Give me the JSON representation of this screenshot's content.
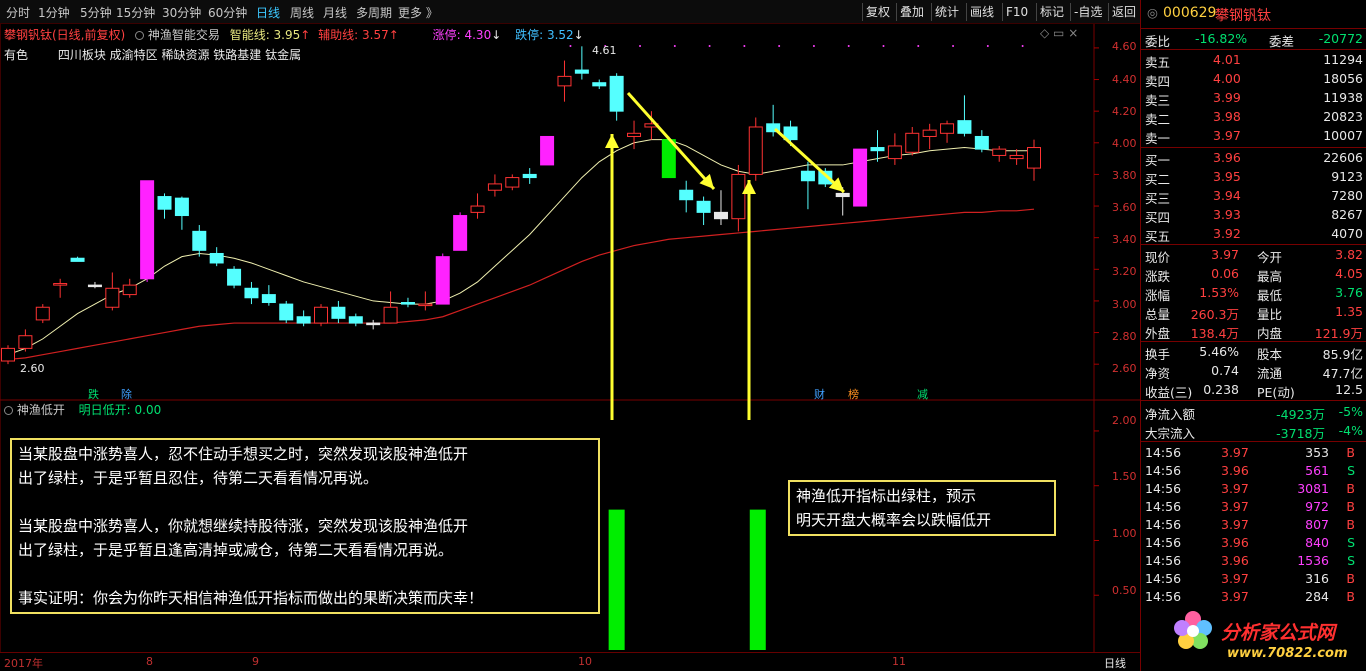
{
  "toolbar": {
    "periods": [
      "分时",
      "1分钟",
      "5分钟",
      "15分钟",
      "30分钟",
      "60分钟",
      "日线",
      "周线",
      "月线",
      "多周期",
      "更多 》"
    ],
    "active_period": "日线",
    "buttons": [
      "复权",
      "叠加",
      "统计",
      "画线",
      "F10",
      "标记",
      "-自选",
      "返回"
    ]
  },
  "chart_header": {
    "stock": "攀钢钒钛(日线,前复权)",
    "indicator": "神渔智能交易",
    "zhineng": "智能线: 3.95",
    "fuzhu": "辅助线: 3.57",
    "zhangting": "涨停: 4.30",
    "dieting": "跌停: 3.52",
    "sector_label": "有色",
    "sectors": "四川板块  成渝特区  稀缺资源  铁路基建  钛金属"
  },
  "price_axis": [
    "4.60",
    "4.40",
    "4.20",
    "4.00",
    "3.80",
    "3.60",
    "3.40",
    "3.20",
    "3.00",
    "2.80",
    "2.60"
  ],
  "sub_axis": [
    "2.00",
    "1.50",
    "1.00",
    "0.50"
  ],
  "markers": {
    "high": "4.61",
    "low": "2.60",
    "die": "跌",
    "chu": "除",
    "cai": "财",
    "bang": "榜",
    "jian": "减"
  },
  "sub_header": {
    "name": "神渔低开",
    "value": "明日低开: 0.00"
  },
  "note_left": {
    "p1_l1": "当某股盘中涨势喜人，忍不住动手想买之时，突然发现该股神渔低开",
    "p1_l2": "出了绿柱，于是乎暂且忍住，待第二天看看情况再说。",
    "p2_l1": "当某股盘中涨势喜人，你就想继续持股待涨，突然发现该股神渔低开",
    "p2_l2": "出了绿柱，于是乎暂且逢高清掉或减仓，待第二天看看情况再说。",
    "p3": "事实证明：你会为你昨天相信神渔低开指标而做出的果断决策而庆幸！"
  },
  "note_right": {
    "l1": "神渔低开指标出绿柱，预示",
    "l2": "明天开盘大概率会以跌幅低开"
  },
  "date_axis": [
    "2017年",
    "8",
    "9",
    "10",
    "11"
  ],
  "date_axis_right": "日线",
  "panel": {
    "code": "000629",
    "name": "攀钢钒钛",
    "weibi_label": "委比",
    "weibi": "-16.82%",
    "weicha_label": "委差",
    "weicha": "-20772",
    "sell": [
      {
        "label": "卖五",
        "price": "4.01",
        "vol": "11294"
      },
      {
        "label": "卖四",
        "price": "4.00",
        "vol": "18056"
      },
      {
        "label": "卖三",
        "price": "3.99",
        "vol": "11938"
      },
      {
        "label": "卖二",
        "price": "3.98",
        "vol": "20823"
      },
      {
        "label": "卖一",
        "price": "3.97",
        "vol": "10007"
      }
    ],
    "buy": [
      {
        "label": "买一",
        "price": "3.96",
        "vol": "22606"
      },
      {
        "label": "买二",
        "price": "3.95",
        "vol": "9123"
      },
      {
        "label": "买三",
        "price": "3.94",
        "vol": "7280"
      },
      {
        "label": "买四",
        "price": "3.93",
        "vol": "8267"
      },
      {
        "label": "买五",
        "price": "3.92",
        "vol": "4070"
      }
    ],
    "quote": [
      {
        "l1": "现价",
        "v1": "3.97",
        "l2": "今开",
        "v2": "3.82"
      },
      {
        "l1": "涨跌",
        "v1": "0.06",
        "l2": "最高",
        "v2": "4.05"
      },
      {
        "l1": "涨幅",
        "v1": "1.53%",
        "l2": "最低",
        "v2": "3.76"
      },
      {
        "l1": "总量",
        "v1": "260.3万",
        "l2": "量比",
        "v2": "1.35"
      },
      {
        "l1": "外盘",
        "v1": "138.4万",
        "l2": "内盘",
        "v2": "121.9万"
      }
    ],
    "stats": [
      {
        "l1": "换手",
        "v1": "5.46%",
        "l2": "股本",
        "v2": "85.9亿"
      },
      {
        "l1": "净资",
        "v1": "0.74",
        "l2": "流通",
        "v2": "47.7亿"
      },
      {
        "l1": "收益(三)",
        "v1": "0.238",
        "l2": "PE(动)",
        "v2": "12.5"
      }
    ],
    "flow": [
      {
        "label": "净流入额",
        "value": "-4923万",
        "pct": "-5%"
      },
      {
        "label": "大宗流入",
        "value": "-3718万",
        "pct": "-4%"
      }
    ],
    "ticks": [
      {
        "time": "14:56",
        "price": "3.97",
        "vol": "353",
        "bs": "B"
      },
      {
        "time": "14:56",
        "price": "3.96",
        "vol": "561",
        "bs": "S"
      },
      {
        "time": "14:56",
        "price": "3.97",
        "vol": "3081",
        "bs": "B"
      },
      {
        "time": "14:56",
        "price": "3.97",
        "vol": "972",
        "bs": "B"
      },
      {
        "time": "14:56",
        "price": "3.97",
        "vol": "807",
        "bs": "B"
      },
      {
        "time": "14:56",
        "price": "3.96",
        "vol": "840",
        "bs": "S"
      },
      {
        "time": "14:56",
        "price": "3.96",
        "vol": "1536",
        "bs": "S"
      },
      {
        "time": "14:56",
        "price": "3.97",
        "vol": "316",
        "bs": "B"
      },
      {
        "time": "14:56",
        "price": "3.97",
        "vol": "284",
        "bs": "B"
      }
    ],
    "watermark": "分析家公式网",
    "watermark_url": "www.70822.com"
  },
  "colors": {
    "up": "#ff3333",
    "up_fill": "#000000",
    "down": "#55ffff",
    "magenta": "#ff22ff",
    "yellow_line": "#f0f0b0",
    "red_line": "#d02020",
    "green_bar": "#00ee00",
    "arrow": "#ffff30"
  },
  "chart_data": {
    "type": "candlestick",
    "title": "攀钢钒钛(日线,前复权)",
    "ylim": [
      2.5,
      4.65
    ],
    "candles": [
      {
        "o": 2.62,
        "h": 2.72,
        "l": 2.6,
        "c": 2.7,
        "dir": "up"
      },
      {
        "o": 2.7,
        "h": 2.82,
        "l": 2.68,
        "c": 2.78,
        "dir": "up"
      },
      {
        "o": 2.88,
        "h": 2.98,
        "l": 2.86,
        "c": 2.96,
        "dir": "up"
      },
      {
        "o": 3.1,
        "h": 3.14,
        "l": 3.02,
        "c": 3.11,
        "dir": "up"
      },
      {
        "o": 3.27,
        "h": 3.28,
        "l": 3.25,
        "c": 3.25,
        "dir": "down"
      },
      {
        "o": 3.1,
        "h": 3.12,
        "l": 3.08,
        "c": 3.1,
        "dir": "flat"
      },
      {
        "o": 2.96,
        "h": 3.18,
        "l": 2.94,
        "c": 3.08,
        "dir": "up"
      },
      {
        "o": 3.04,
        "h": 3.14,
        "l": 3.02,
        "c": 3.1,
        "dir": "up"
      },
      {
        "o": 3.14,
        "h": 3.44,
        "l": 3.12,
        "c": 3.76,
        "dir": "mag"
      },
      {
        "o": 3.66,
        "h": 3.68,
        "l": 3.52,
        "c": 3.58,
        "dir": "down"
      },
      {
        "o": 3.65,
        "h": 3.66,
        "l": 3.45,
        "c": 3.54,
        "dir": "down"
      },
      {
        "o": 3.44,
        "h": 3.48,
        "l": 3.28,
        "c": 3.32,
        "dir": "down"
      },
      {
        "o": 3.3,
        "h": 3.34,
        "l": 3.22,
        "c": 3.24,
        "dir": "down"
      },
      {
        "o": 3.2,
        "h": 3.22,
        "l": 3.08,
        "c": 3.1,
        "dir": "down"
      },
      {
        "o": 3.08,
        "h": 3.12,
        "l": 2.98,
        "c": 3.02,
        "dir": "down"
      },
      {
        "o": 3.04,
        "h": 3.1,
        "l": 2.97,
        "c": 2.99,
        "dir": "down"
      },
      {
        "o": 2.98,
        "h": 3.0,
        "l": 2.86,
        "c": 2.88,
        "dir": "down"
      },
      {
        "o": 2.9,
        "h": 2.94,
        "l": 2.84,
        "c": 2.86,
        "dir": "down"
      },
      {
        "o": 2.86,
        "h": 2.98,
        "l": 2.84,
        "c": 2.96,
        "dir": "up"
      },
      {
        "o": 2.96,
        "h": 3.0,
        "l": 2.86,
        "c": 2.89,
        "dir": "down"
      },
      {
        "o": 2.9,
        "h": 2.92,
        "l": 2.84,
        "c": 2.86,
        "dir": "down"
      },
      {
        "o": 2.86,
        "h": 2.88,
        "l": 2.82,
        "c": 2.85,
        "dir": "flat"
      },
      {
        "o": 2.86,
        "h": 3.06,
        "l": 2.86,
        "c": 2.96,
        "dir": "up"
      },
      {
        "o": 2.98,
        "h": 3.02,
        "l": 2.96,
        "c": 2.99,
        "dir": "down"
      },
      {
        "o": 2.98,
        "h": 3.06,
        "l": 2.94,
        "c": 2.98,
        "dir": "up"
      },
      {
        "o": 2.98,
        "h": 3.3,
        "l": 2.98,
        "c": 3.28,
        "dir": "mag"
      },
      {
        "o": 3.32,
        "h": 3.56,
        "l": 3.32,
        "c": 3.54,
        "dir": "mag"
      },
      {
        "o": 3.56,
        "h": 3.68,
        "l": 3.52,
        "c": 3.6,
        "dir": "up"
      },
      {
        "o": 3.7,
        "h": 3.8,
        "l": 3.66,
        "c": 3.74,
        "dir": "up"
      },
      {
        "o": 3.72,
        "h": 3.8,
        "l": 3.7,
        "c": 3.78,
        "dir": "up"
      },
      {
        "o": 3.8,
        "h": 3.84,
        "l": 3.74,
        "c": 3.78,
        "dir": "down"
      },
      {
        "o": 3.86,
        "h": 4.04,
        "l": 3.86,
        "c": 4.04,
        "dir": "mag"
      },
      {
        "o": 4.36,
        "h": 4.52,
        "l": 4.26,
        "c": 4.42,
        "dir": "up"
      },
      {
        "o": 4.46,
        "h": 4.61,
        "l": 4.4,
        "c": 4.44,
        "dir": "down"
      },
      {
        "o": 4.38,
        "h": 4.4,
        "l": 4.34,
        "c": 4.36,
        "dir": "down"
      },
      {
        "o": 4.42,
        "h": 4.44,
        "l": 4.14,
        "c": 4.2,
        "dir": "down"
      },
      {
        "o": 4.06,
        "h": 4.14,
        "l": 3.96,
        "c": 4.04,
        "dir": "up"
      },
      {
        "o": 4.1,
        "h": 4.2,
        "l": 4.02,
        "c": 4.12,
        "dir": "up"
      },
      {
        "o": 4.02,
        "h": 4.04,
        "l": 3.78,
        "c": 3.78,
        "dir": "green"
      },
      {
        "o": 3.7,
        "h": 3.76,
        "l": 3.56,
        "c": 3.64,
        "dir": "down"
      },
      {
        "o": 3.63,
        "h": 3.66,
        "l": 3.48,
        "c": 3.56,
        "dir": "down"
      },
      {
        "o": 3.56,
        "h": 3.7,
        "l": 3.48,
        "c": 3.52,
        "dir": "flat"
      },
      {
        "o": 3.52,
        "h": 3.86,
        "l": 3.44,
        "c": 3.8,
        "dir": "up"
      },
      {
        "o": 3.8,
        "h": 4.16,
        "l": 3.76,
        "c": 4.1,
        "dir": "up"
      },
      {
        "o": 4.12,
        "h": 4.24,
        "l": 4.04,
        "c": 4.07,
        "dir": "down"
      },
      {
        "o": 4.1,
        "h": 4.14,
        "l": 3.98,
        "c": 4.02,
        "dir": "down"
      },
      {
        "o": 3.82,
        "h": 3.88,
        "l": 3.58,
        "c": 3.76,
        "dir": "down"
      },
      {
        "o": 3.82,
        "h": 3.84,
        "l": 3.72,
        "c": 3.74,
        "dir": "down"
      },
      {
        "o": 3.68,
        "h": 3.72,
        "l": 3.54,
        "c": 3.66,
        "dir": "flat"
      },
      {
        "o": 3.6,
        "h": 3.96,
        "l": 3.6,
        "c": 3.96,
        "dir": "mag"
      },
      {
        "o": 3.95,
        "h": 4.08,
        "l": 3.88,
        "c": 3.97,
        "dir": "down"
      },
      {
        "o": 3.9,
        "h": 4.06,
        "l": 3.86,
        "c": 3.98,
        "dir": "up"
      },
      {
        "o": 3.94,
        "h": 4.1,
        "l": 3.92,
        "c": 4.06,
        "dir": "up"
      },
      {
        "o": 4.04,
        "h": 4.12,
        "l": 3.96,
        "c": 4.08,
        "dir": "up"
      },
      {
        "o": 4.06,
        "h": 4.14,
        "l": 4.0,
        "c": 4.12,
        "dir": "up"
      },
      {
        "o": 4.14,
        "h": 4.3,
        "l": 4.04,
        "c": 4.06,
        "dir": "down"
      },
      {
        "o": 4.04,
        "h": 4.08,
        "l": 3.94,
        "c": 3.96,
        "dir": "down"
      },
      {
        "o": 3.96,
        "h": 3.98,
        "l": 3.88,
        "c": 3.92,
        "dir": "up"
      },
      {
        "o": 3.92,
        "h": 3.96,
        "l": 3.86,
        "c": 3.9,
        "dir": "up"
      },
      {
        "o": 3.84,
        "h": 4.02,
        "l": 3.76,
        "c": 3.97,
        "dir": "up"
      }
    ],
    "ma_short": [
      2.66,
      2.7,
      2.76,
      2.84,
      2.92,
      2.98,
      3.04,
      3.08,
      3.14,
      3.22,
      3.28,
      3.3,
      3.29,
      3.27,
      3.24,
      3.2,
      3.16,
      3.12,
      3.09,
      3.06,
      3.03,
      3.0,
      2.99,
      2.98,
      2.98,
      3.0,
      3.05,
      3.12,
      3.22,
      3.32,
      3.42,
      3.54,
      3.66,
      3.78,
      3.88,
      3.95,
      4.0,
      4.02,
      4.02,
      3.98,
      3.92,
      3.86,
      3.82,
      3.8,
      3.82,
      3.84,
      3.86,
      3.86,
      3.86,
      3.88,
      3.9,
      3.92,
      3.93,
      3.95,
      3.96,
      3.97,
      3.96,
      3.95,
      3.95,
      3.95
    ],
    "ma_long": [
      2.63,
      2.64,
      2.66,
      2.68,
      2.7,
      2.72,
      2.74,
      2.76,
      2.78,
      2.8,
      2.82,
      2.84,
      2.85,
      2.86,
      2.86,
      2.86,
      2.86,
      2.86,
      2.86,
      2.86,
      2.86,
      2.86,
      2.86,
      2.87,
      2.88,
      2.9,
      2.94,
      2.98,
      3.02,
      3.06,
      3.1,
      3.15,
      3.2,
      3.25,
      3.29,
      3.32,
      3.35,
      3.37,
      3.39,
      3.4,
      3.41,
      3.42,
      3.43,
      3.44,
      3.45,
      3.46,
      3.47,
      3.48,
      3.49,
      3.5,
      3.51,
      3.52,
      3.53,
      3.54,
      3.55,
      3.56,
      3.56,
      3.57,
      3.57,
      3.58
    ],
    "sub_bars": [
      {
        "index": 35,
        "value": 1.3
      },
      {
        "index": 43,
        "value": 1.3
      }
    ],
    "sub_ylim": [
      0,
      2.1
    ]
  }
}
